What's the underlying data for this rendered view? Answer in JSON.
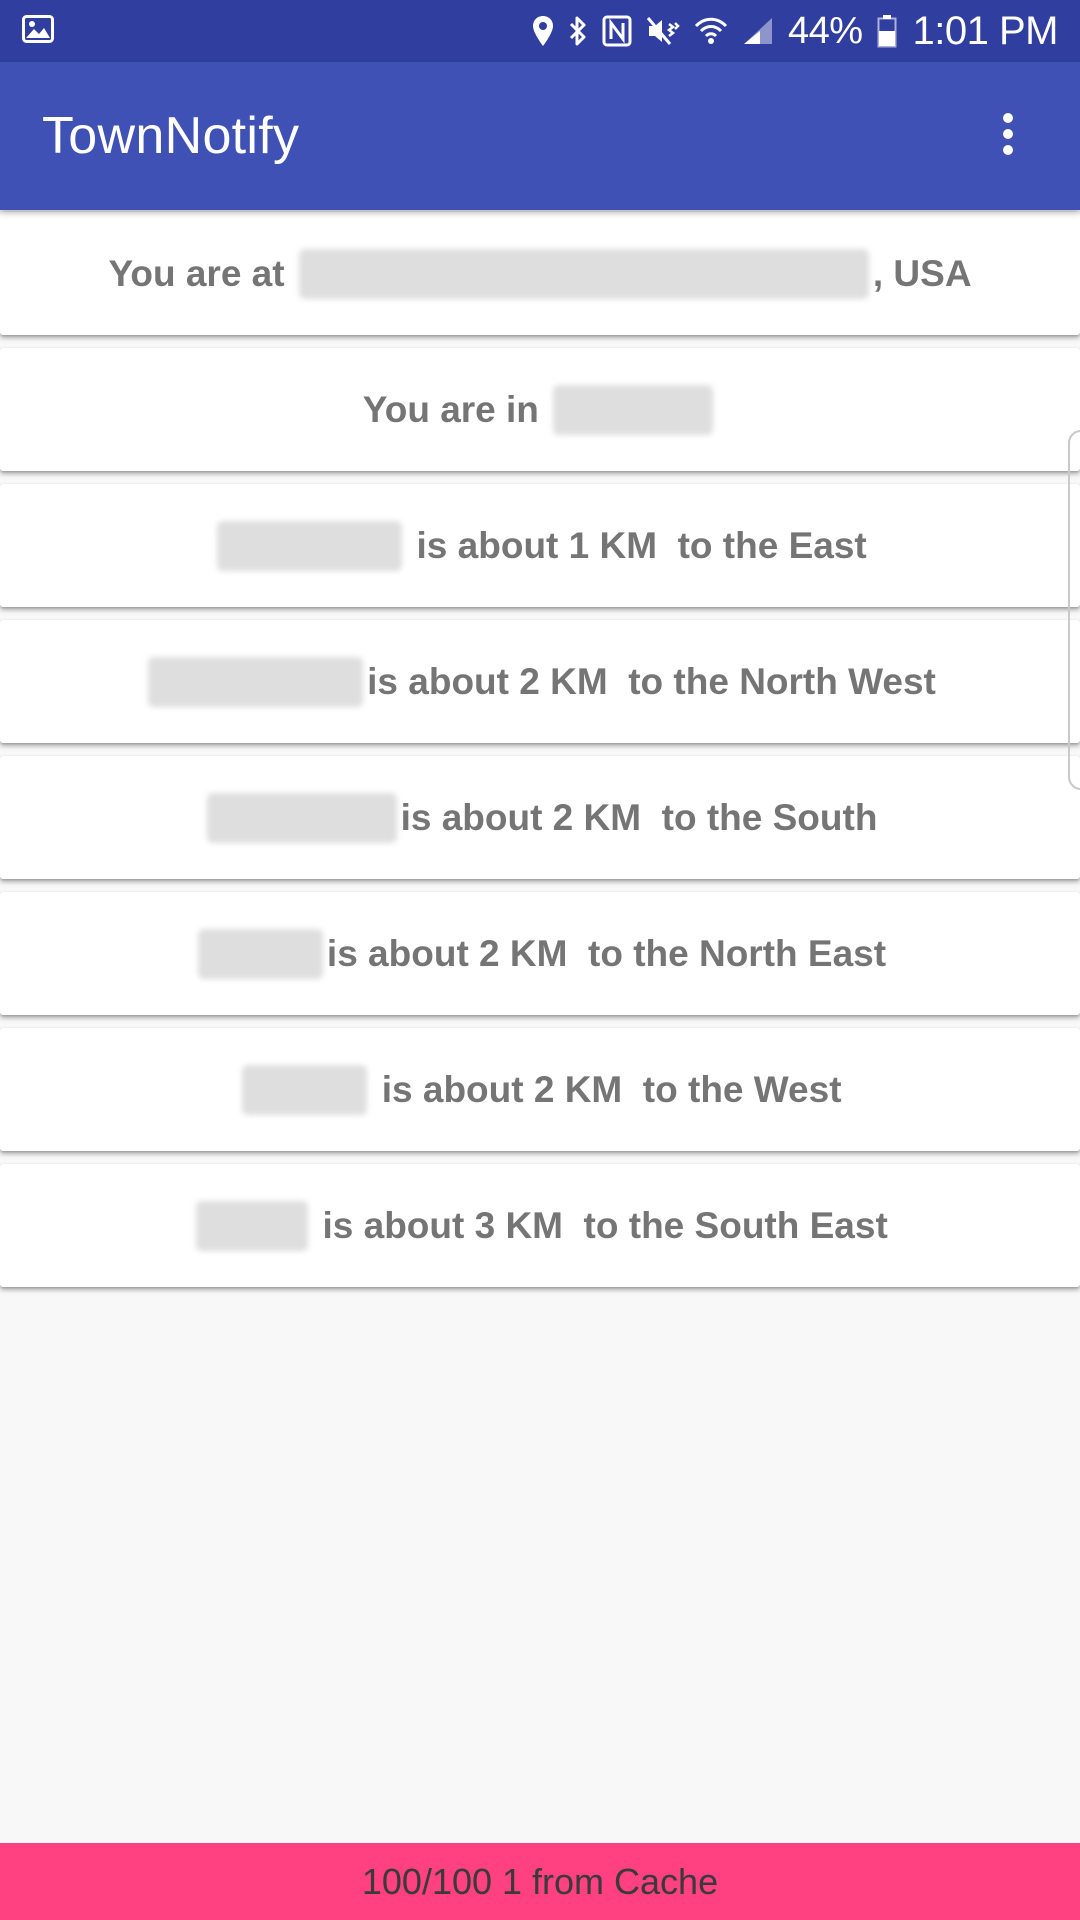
{
  "status_bar": {
    "battery_percent": "44%",
    "time": "1:01 PM",
    "icons": [
      "image-icon",
      "location-icon",
      "bluetooth-icon",
      "nfc-icon",
      "mute-vibrate-icon",
      "wifi-icon",
      "signal-icon",
      "battery-icon"
    ]
  },
  "app_bar": {
    "title": "TownNotify",
    "overflow_icon": "more-vertical-icon"
  },
  "cards": [
    {
      "prefix": "You are at ",
      "suffix": ", USA"
    },
    {
      "prefix": "You are in ",
      "suffix": ""
    },
    {
      "prefix": "",
      "suffix": " is about 1 KM  to the East"
    },
    {
      "prefix": "",
      "suffix": "is about 2 KM  to the North West"
    },
    {
      "prefix": "",
      "suffix": "is about 2 KM  to the South"
    },
    {
      "prefix": "",
      "suffix": "is about 2 KM  to the North East"
    },
    {
      "prefix": "",
      "suffix": " is about 2 KM  to the West"
    },
    {
      "prefix": "",
      "suffix": " is about 3 KM  to the South East"
    }
  ],
  "footer": {
    "text": "100/100 1 from Cache"
  },
  "colors": {
    "status_bar": "#303f9f",
    "app_bar": "#3f51b5",
    "footer": "#ff4081",
    "card_text": "#757575"
  }
}
